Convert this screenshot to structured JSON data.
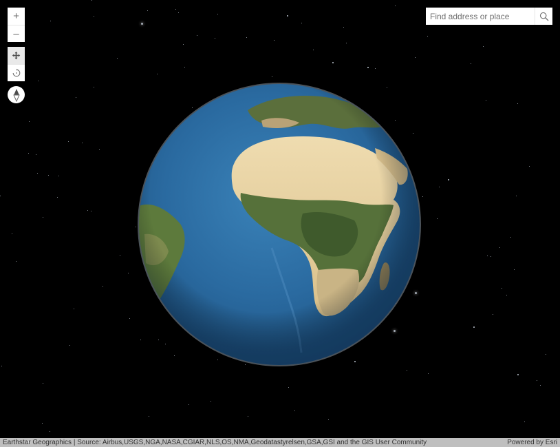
{
  "map": {
    "view_type": "3D globe",
    "basemap": "satellite imagery",
    "visible_region": "Africa and South Atlantic"
  },
  "zoom": {
    "zoom_in_label": "+",
    "zoom_out_label": "–"
  },
  "navigation": {
    "pan_icon": "pan-arrows-icon",
    "rotate_icon": "rotate-icon",
    "compass_icon": "compass-icon",
    "active_mode": "pan"
  },
  "search": {
    "placeholder": "Find address or place",
    "value": "",
    "icon": "magnifier-icon"
  },
  "attribution": {
    "source": "Earthstar Geographics | Source: Airbus,USGS,NGA,NASA,CGIAR,NLS,OS,NMA,Geodatastyrelsen,GSA,GSI and the GIS User Community",
    "powered_by": "Powered by Esri"
  },
  "colors": {
    "space": "#000000",
    "ocean": "#2f6ea6",
    "desert": "#e8d4a8",
    "vegetation": "#4f6a32",
    "widget_icon": "#6e6e6e"
  }
}
